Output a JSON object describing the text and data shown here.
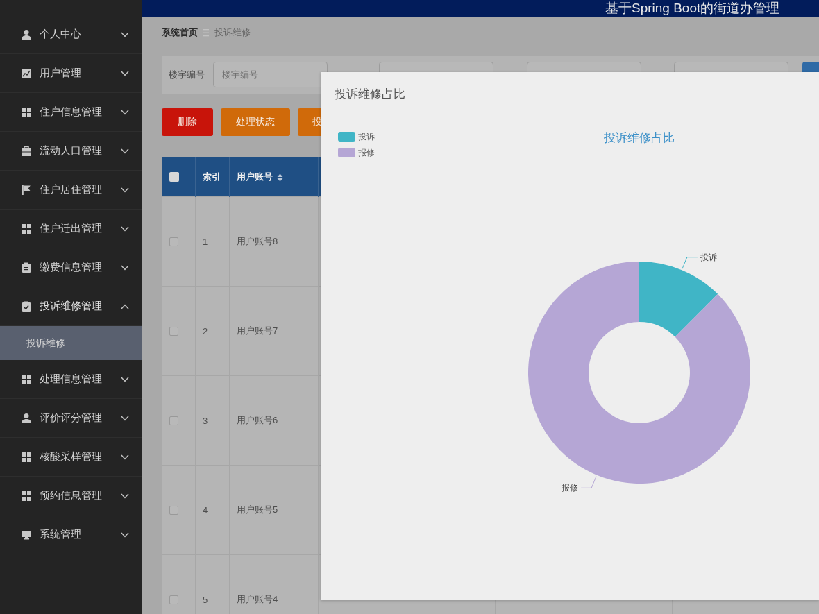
{
  "header": {
    "title": "基于Spring Boot的街道办管理"
  },
  "sidebar": {
    "items": [
      {
        "label": "个人中心",
        "expanded": false
      },
      {
        "label": "用户管理",
        "expanded": false
      },
      {
        "label": "住户信息管理",
        "expanded": false
      },
      {
        "label": "流动人口管理",
        "expanded": false
      },
      {
        "label": "住户居住管理",
        "expanded": false
      },
      {
        "label": "住户迁出管理",
        "expanded": false
      },
      {
        "label": "缴费信息管理",
        "expanded": false
      },
      {
        "label": "投诉维修管理",
        "expanded": true,
        "children": [
          {
            "label": "投诉维修",
            "selected": true
          }
        ]
      },
      {
        "label": "处理信息管理",
        "expanded": false
      },
      {
        "label": "评价评分管理",
        "expanded": false
      },
      {
        "label": "核酸采样管理",
        "expanded": false
      },
      {
        "label": "预约信息管理",
        "expanded": false
      },
      {
        "label": "系统管理",
        "expanded": false
      }
    ]
  },
  "breadcrumb": [
    "系统首页",
    "投诉维修"
  ],
  "search": {
    "fields": [
      {
        "label": "楼宇编号",
        "placeholder": "楼宇编号",
        "kind": "input"
      },
      {
        "kind": "input"
      },
      {
        "kind": "select"
      },
      {
        "kind": "select"
      }
    ]
  },
  "actions": [
    {
      "label": "删除",
      "color": "#c8140a"
    },
    {
      "label": "处理状态",
      "color": "#d06a0a"
    },
    {
      "label": "投",
      "color": "#d06a0a"
    }
  ],
  "table": {
    "select_all": {
      "checked": false
    },
    "columns": [
      {
        "label": "索引",
        "sortable": false
      },
      {
        "label": "用户账号",
        "sortable": true
      }
    ],
    "rows": [
      {
        "checked": false,
        "cells": [
          "1",
          "用户账号8"
        ]
      },
      {
        "checked": false,
        "cells": [
          "2",
          "用户账号7"
        ]
      },
      {
        "checked": false,
        "cells": [
          "3",
          "用户账号6"
        ]
      },
      {
        "checked": false,
        "cells": [
          "4",
          "用户账号5"
        ]
      },
      {
        "checked": false,
        "cells": [
          "5",
          "用户账号4"
        ]
      }
    ]
  },
  "dialog": {
    "title": "投诉维修占比",
    "chart_data": {
      "type": "donut",
      "title": "投诉维修占比",
      "categories": [
        "投诉",
        "报修"
      ],
      "values": [
        12.5,
        87.5
      ],
      "legend": true
    }
  }
}
